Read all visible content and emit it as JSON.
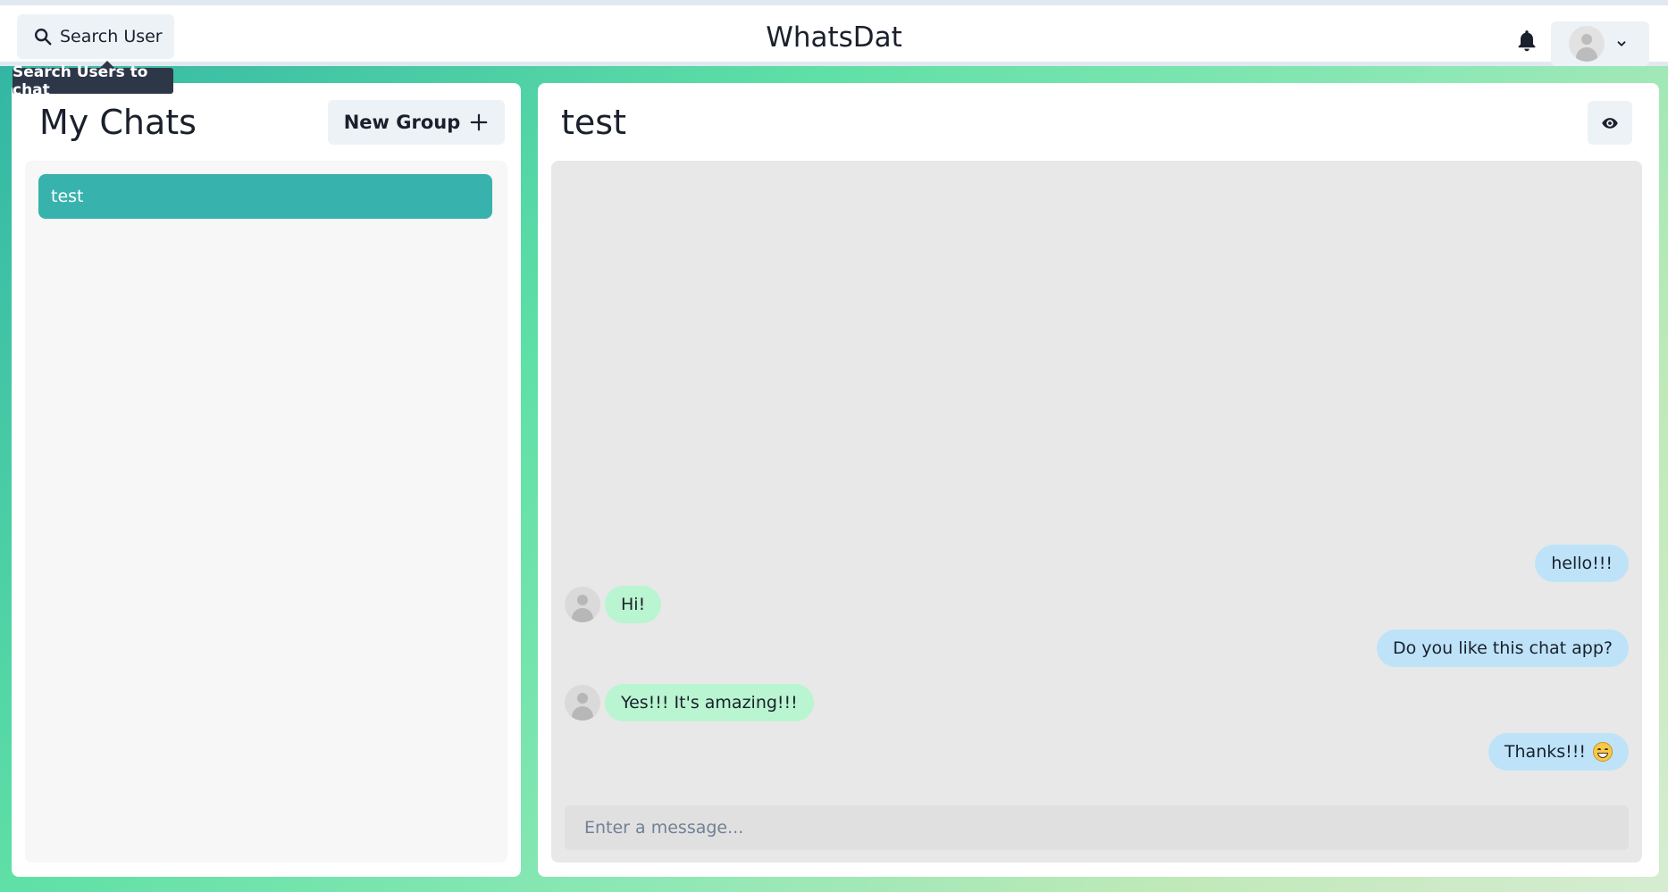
{
  "header": {
    "search_label": "Search User",
    "search_tooltip": "Search Users to chat",
    "app_title": "WhatsDat"
  },
  "sidebar": {
    "title": "My Chats",
    "new_group_label": "New Group",
    "chats": [
      {
        "name": "test",
        "selected": true
      }
    ]
  },
  "chat": {
    "title": "test",
    "messages": [
      {
        "text": "hello!!!",
        "from": "me"
      },
      {
        "text": "Hi!",
        "from": "them"
      },
      {
        "text": "Do you like this chat app?",
        "from": "me"
      },
      {
        "text": "Yes!!! It's amazing!!!",
        "from": "them"
      },
      {
        "text": "Thanks!!!",
        "from": "me",
        "emoji": "grinning-face"
      }
    ],
    "input_placeholder": "Enter a message..."
  },
  "colors": {
    "accent": "#38b2ac",
    "my_bubble": "#bee3f8",
    "their_bubble": "#b9f5d0"
  },
  "icons": [
    "search-icon",
    "bell-icon",
    "avatar-icon",
    "chevron-down-icon",
    "plus-icon",
    "eye-icon"
  ]
}
